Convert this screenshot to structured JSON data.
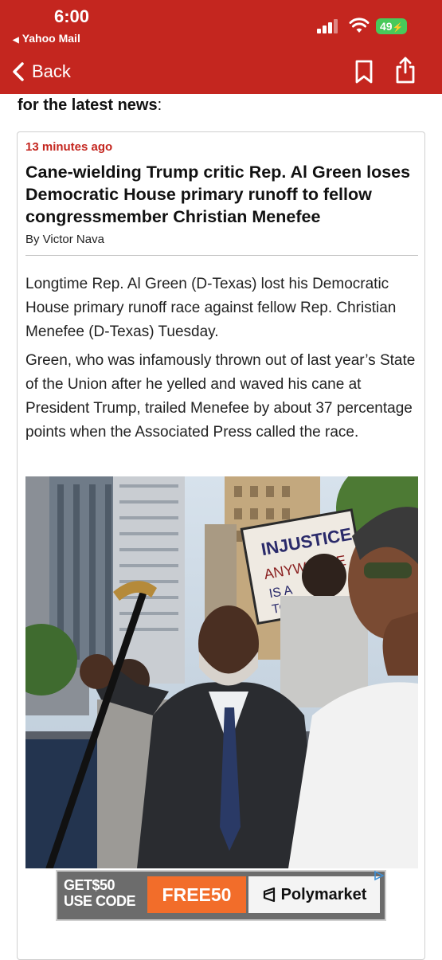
{
  "status_bar": {
    "time": "6:00",
    "back_app": "Yahoo Mail",
    "battery": "49"
  },
  "nav": {
    "back_label": "Back",
    "icons": [
      "chevron-left-icon",
      "bookmark-icon",
      "share-icon"
    ]
  },
  "content": {
    "lead_in": "for the latest news",
    "lead_in_punct": ":",
    "card": {
      "timestamp": "13 minutes ago",
      "headline": "Cane-wielding Trump critic Rep. Al Green loses Democratic House primary runoff to fellow congressmember Christian Menefee",
      "byline": "By Victor Nava",
      "paragraphs": [
        "Longtime Rep. Al Green (D-Texas) lost his Democratic House primary runoff race against fellow Rep. Christian Menefee (D-Texas) Tuesday.",
        "Green, who was infamously thrown out of last year’s State of the Union after he yelled and waved his cane at President Trump, trailed Menefee by about 37 percentage points when the Associated Press called the race."
      ],
      "photo_sign_text": [
        "INJUSTICE",
        "ANYWHERE",
        "IS A",
        "TO"
      ]
    }
  },
  "ad": {
    "code_line1": "GET$50",
    "code_line2": "USE CODE",
    "promo": "FREE50",
    "brand": "Polymarket",
    "colors": {
      "promo": "#f26d2a",
      "background": "#6c6c6c"
    }
  },
  "colors": {
    "header": "#c4261f",
    "timestamp": "#c4261f",
    "battery": "#48c95a"
  }
}
